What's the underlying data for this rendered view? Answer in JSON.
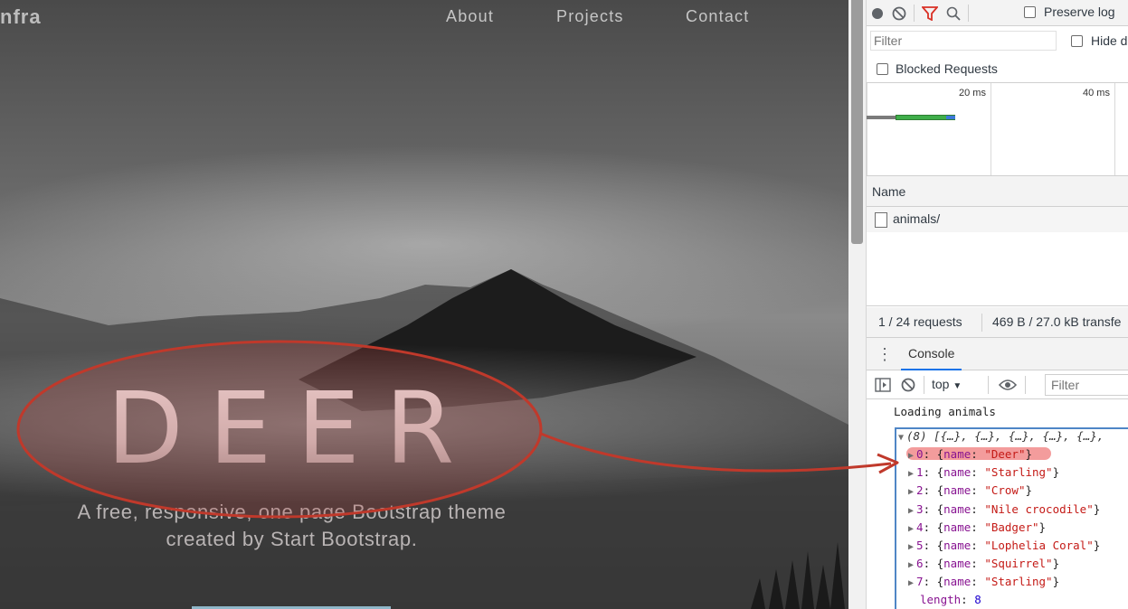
{
  "site": {
    "brand": "nfra",
    "nav": [
      "About",
      "Projects",
      "Contact"
    ],
    "hero_title": "DEER",
    "hero_subtitle_line1": "A free, responsive, one page Bootstrap theme",
    "hero_subtitle_line2": "created by Start Bootstrap."
  },
  "network": {
    "preserve_log_label": "Preserve log",
    "filter_placeholder": "Filter",
    "hide_label": "Hide d",
    "blocked_requests_label": "Blocked Requests",
    "timeline_ticks": [
      "20 ms",
      "40 ms"
    ],
    "name_header": "Name",
    "requests": [
      "animals/"
    ],
    "status_requests": "1 / 24 requests",
    "status_transfer": "469 B / 27.0 kB transfe"
  },
  "console": {
    "tab_label": "Console",
    "context": "top",
    "filter_placeholder": "Filter",
    "log_line": "Loading animals",
    "array_summary": "(8) [{…}, {…}, {…}, {…}, {…},",
    "items": [
      {
        "index": "0",
        "name": "\"Deer\""
      },
      {
        "index": "1",
        "name": "\"Starling\""
      },
      {
        "index": "2",
        "name": "\"Crow\""
      },
      {
        "index": "3",
        "name": "\"Nile crocodile\""
      },
      {
        "index": "4",
        "name": "\"Badger\""
      },
      {
        "index": "5",
        "name": "\"Lophelia Coral\""
      },
      {
        "index": "6",
        "name": "\"Squirrel\""
      },
      {
        "index": "7",
        "name": "\"Starling\""
      }
    ],
    "name_key": "name",
    "length_key": "length",
    "length_value": "8"
  },
  "colors": {
    "annotation_red": "#c0392b",
    "highlight_red": "#eb5a5a",
    "devtools_blue": "#1a73e8"
  }
}
